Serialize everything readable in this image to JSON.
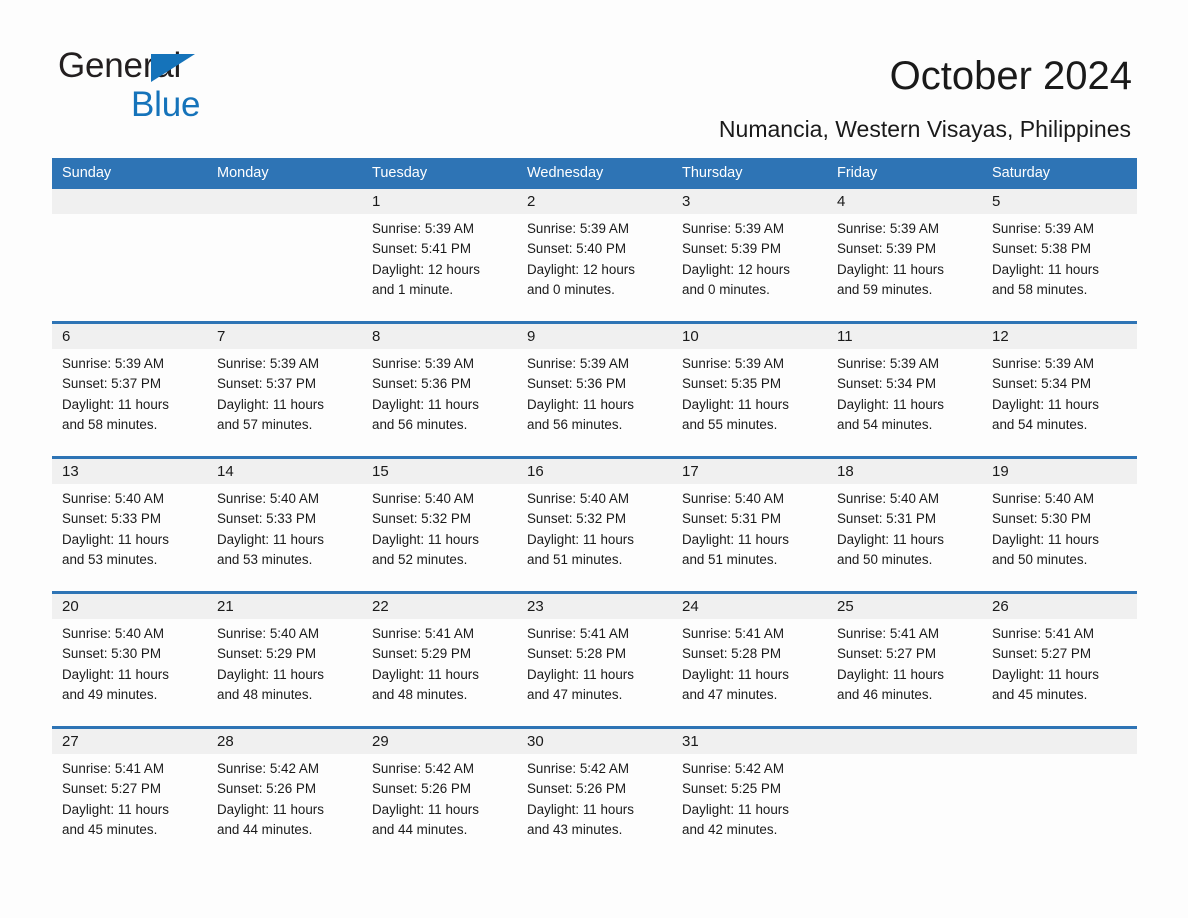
{
  "brand": {
    "line1": "General",
    "line2": "Blue",
    "triangle_color": "#1573ba"
  },
  "header": {
    "title": "October 2024",
    "subtitle": "Numancia, Western Visayas, Philippines"
  },
  "theme": {
    "header_blue": "#2e74b5",
    "daynum_band": "#f0f0f0",
    "page_bg": "#fdfdfd",
    "text": "#1a1a1a"
  },
  "columns": [
    "Sunday",
    "Monday",
    "Tuesday",
    "Wednesday",
    "Thursday",
    "Friday",
    "Saturday"
  ],
  "weeks": [
    [
      {
        "day": "",
        "info": ""
      },
      {
        "day": "",
        "info": ""
      },
      {
        "day": "1",
        "info": "Sunrise: 5:39 AM\nSunset: 5:41 PM\nDaylight: 12 hours\nand 1 minute."
      },
      {
        "day": "2",
        "info": "Sunrise: 5:39 AM\nSunset: 5:40 PM\nDaylight: 12 hours\nand 0 minutes."
      },
      {
        "day": "3",
        "info": "Sunrise: 5:39 AM\nSunset: 5:39 PM\nDaylight: 12 hours\nand 0 minutes."
      },
      {
        "day": "4",
        "info": "Sunrise: 5:39 AM\nSunset: 5:39 PM\nDaylight: 11 hours\nand 59 minutes."
      },
      {
        "day": "5",
        "info": "Sunrise: 5:39 AM\nSunset: 5:38 PM\nDaylight: 11 hours\nand 58 minutes."
      }
    ],
    [
      {
        "day": "6",
        "info": "Sunrise: 5:39 AM\nSunset: 5:37 PM\nDaylight: 11 hours\nand 58 minutes."
      },
      {
        "day": "7",
        "info": "Sunrise: 5:39 AM\nSunset: 5:37 PM\nDaylight: 11 hours\nand 57 minutes."
      },
      {
        "day": "8",
        "info": "Sunrise: 5:39 AM\nSunset: 5:36 PM\nDaylight: 11 hours\nand 56 minutes."
      },
      {
        "day": "9",
        "info": "Sunrise: 5:39 AM\nSunset: 5:36 PM\nDaylight: 11 hours\nand 56 minutes."
      },
      {
        "day": "10",
        "info": "Sunrise: 5:39 AM\nSunset: 5:35 PM\nDaylight: 11 hours\nand 55 minutes."
      },
      {
        "day": "11",
        "info": "Sunrise: 5:39 AM\nSunset: 5:34 PM\nDaylight: 11 hours\nand 54 minutes."
      },
      {
        "day": "12",
        "info": "Sunrise: 5:39 AM\nSunset: 5:34 PM\nDaylight: 11 hours\nand 54 minutes."
      }
    ],
    [
      {
        "day": "13",
        "info": "Sunrise: 5:40 AM\nSunset: 5:33 PM\nDaylight: 11 hours\nand 53 minutes."
      },
      {
        "day": "14",
        "info": "Sunrise: 5:40 AM\nSunset: 5:33 PM\nDaylight: 11 hours\nand 53 minutes."
      },
      {
        "day": "15",
        "info": "Sunrise: 5:40 AM\nSunset: 5:32 PM\nDaylight: 11 hours\nand 52 minutes."
      },
      {
        "day": "16",
        "info": "Sunrise: 5:40 AM\nSunset: 5:32 PM\nDaylight: 11 hours\nand 51 minutes."
      },
      {
        "day": "17",
        "info": "Sunrise: 5:40 AM\nSunset: 5:31 PM\nDaylight: 11 hours\nand 51 minutes."
      },
      {
        "day": "18",
        "info": "Sunrise: 5:40 AM\nSunset: 5:31 PM\nDaylight: 11 hours\nand 50 minutes."
      },
      {
        "day": "19",
        "info": "Sunrise: 5:40 AM\nSunset: 5:30 PM\nDaylight: 11 hours\nand 50 minutes."
      }
    ],
    [
      {
        "day": "20",
        "info": "Sunrise: 5:40 AM\nSunset: 5:30 PM\nDaylight: 11 hours\nand 49 minutes."
      },
      {
        "day": "21",
        "info": "Sunrise: 5:40 AM\nSunset: 5:29 PM\nDaylight: 11 hours\nand 48 minutes."
      },
      {
        "day": "22",
        "info": "Sunrise: 5:41 AM\nSunset: 5:29 PM\nDaylight: 11 hours\nand 48 minutes."
      },
      {
        "day": "23",
        "info": "Sunrise: 5:41 AM\nSunset: 5:28 PM\nDaylight: 11 hours\nand 47 minutes."
      },
      {
        "day": "24",
        "info": "Sunrise: 5:41 AM\nSunset: 5:28 PM\nDaylight: 11 hours\nand 47 minutes."
      },
      {
        "day": "25",
        "info": "Sunrise: 5:41 AM\nSunset: 5:27 PM\nDaylight: 11 hours\nand 46 minutes."
      },
      {
        "day": "26",
        "info": "Sunrise: 5:41 AM\nSunset: 5:27 PM\nDaylight: 11 hours\nand 45 minutes."
      }
    ],
    [
      {
        "day": "27",
        "info": "Sunrise: 5:41 AM\nSunset: 5:27 PM\nDaylight: 11 hours\nand 45 minutes."
      },
      {
        "day": "28",
        "info": "Sunrise: 5:42 AM\nSunset: 5:26 PM\nDaylight: 11 hours\nand 44 minutes."
      },
      {
        "day": "29",
        "info": "Sunrise: 5:42 AM\nSunset: 5:26 PM\nDaylight: 11 hours\nand 44 minutes."
      },
      {
        "day": "30",
        "info": "Sunrise: 5:42 AM\nSunset: 5:26 PM\nDaylight: 11 hours\nand 43 minutes."
      },
      {
        "day": "31",
        "info": "Sunrise: 5:42 AM\nSunset: 5:25 PM\nDaylight: 11 hours\nand 42 minutes."
      },
      {
        "day": "",
        "info": ""
      },
      {
        "day": "",
        "info": ""
      }
    ]
  ]
}
